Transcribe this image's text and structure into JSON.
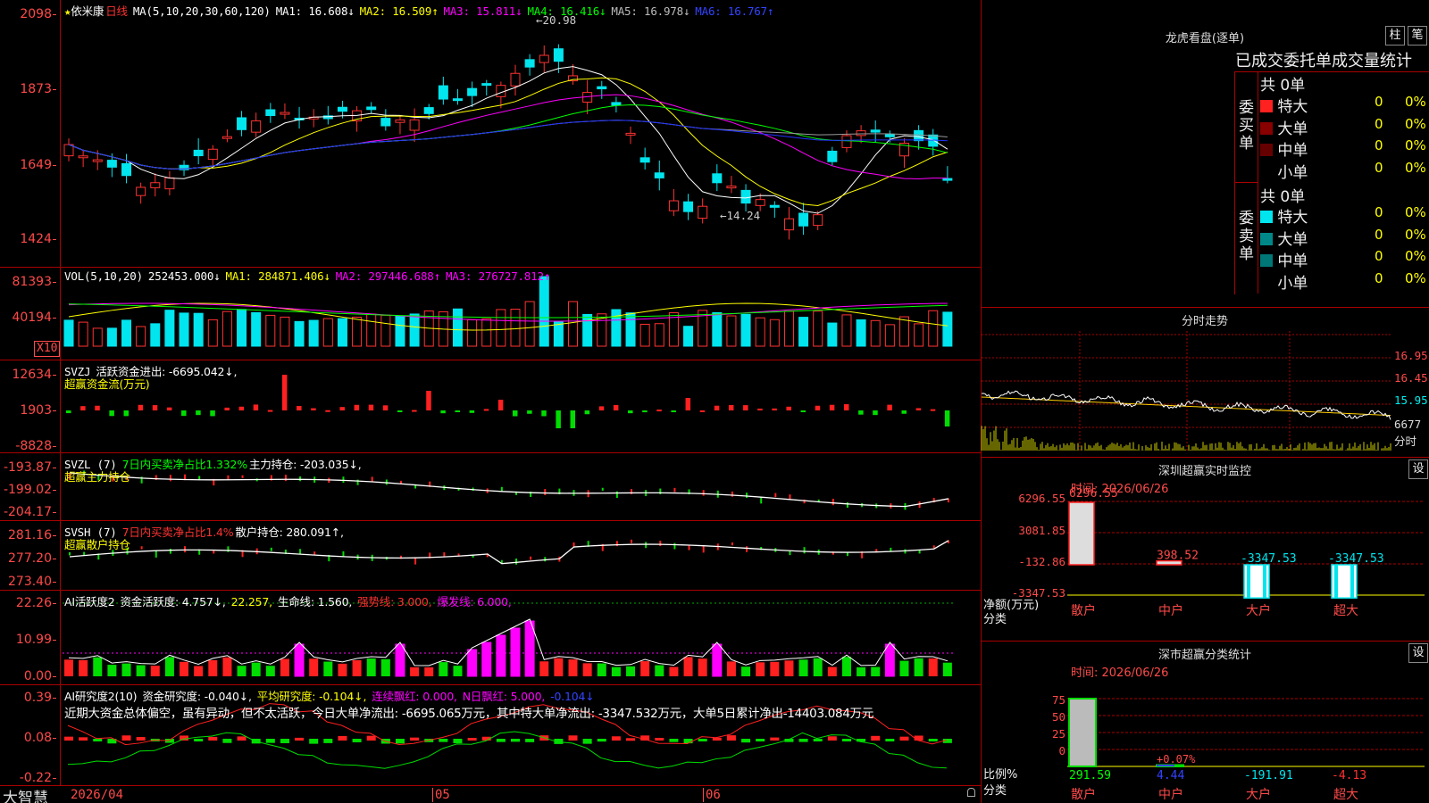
{
  "app": {
    "name": "大智慧",
    "stock": "依米康",
    "period": "日线"
  },
  "colors": {
    "up": "#ff3232",
    "down": "#00e5ee",
    "ma1": "#ffffff",
    "ma2": "#ffff00",
    "ma3": "#ff00ff",
    "ma4": "#00ff00",
    "ma5": "#999999",
    "ma6": "#2233ff",
    "axis": "#ff4a4a",
    "grid": "#aa0000"
  },
  "kline": {
    "header": {
      "ma_label": "MA(5,10,20,30,60,120)",
      "ma1": "MA1: 16.608↓",
      "ma2": "MA2: 16.509↑",
      "ma3": "MA3: 15.811↓",
      "ma4": "MA4: 16.416↓",
      "ma5": "MA5: 16.978↓",
      "ma6": "MA6: 16.767↑"
    },
    "ticks": [
      "2098",
      "1873",
      "1649",
      "1424"
    ],
    "high_label": "20.98",
    "low_label": "14.24"
  },
  "vol": {
    "header": {
      "label": "VOL(5,10,20)",
      "value": "252453.000↓",
      "ma1": "MA1: 284871.406↓",
      "ma2": "MA2: 297446.688↑",
      "ma3": "MA3: 276727.812↑"
    },
    "ticks": [
      "81393",
      "40194"
    ],
    "unit": "X10"
  },
  "svzj": {
    "header": {
      "label": "SVZJ",
      "text": "活跃资金进出: -6695.042↓,",
      "sub": "超赢资金流(万元)"
    },
    "ticks": [
      "12634",
      "1903",
      "-8828"
    ]
  },
  "svzl": {
    "header": {
      "label": "SVZL (7)",
      "text1": "7日内买卖净占比1.332%",
      "text2": "主力持仓: -203.035↓,",
      "sub": "超赢主力持仓"
    },
    "ticks": [
      "-193.87",
      "-199.02",
      "-204.17"
    ]
  },
  "svsh": {
    "header": {
      "label": "SVSH (7)",
      "text1": "7日内买卖净占比1.4%",
      "text2": "散户持仓: 280.091↑,",
      "sub": "超赢散户持仓"
    },
    "ticks": [
      "281.16",
      "277.20",
      "273.40"
    ]
  },
  "ai1": {
    "header": {
      "label": "AI活跃度2",
      "a": "资金活跃度: 4.757↓,",
      "b": "22.257,",
      "c": "生命线: 1.560,",
      "d": "强势线: 3.000,",
      "e": "爆发线: 6.000,"
    },
    "ticks": [
      "22.26",
      "10.99",
      "0.00"
    ]
  },
  "ai2": {
    "header": {
      "label": "AI研究度2(10)",
      "a": "资金研究度: -0.040↓,",
      "b": "平均研究度: -0.104↓,",
      "c": "连续飘红: 0.000,",
      "d": "N日飘红: 5.000,",
      "e": "-0.104↓"
    },
    "ticks": [
      "0.39",
      "0.08",
      "-0.22"
    ],
    "comment": "近期大资金总体偏空，虽有异动，但不太活跃，今日大单净流出: -6695.065万元，其中特大单净流出: -3347.532万元，大单5日累计净出-14403.084万元"
  },
  "dates": [
    "2026/04",
    "05",
    "06"
  ],
  "right": {
    "lhb": {
      "title": "龙虎看盘(逐单)",
      "btn1": "柱",
      "btn2": "笔",
      "subtitle": "已成交委托单成交量统计",
      "buy_label": "委买单",
      "sell_label": "委卖单",
      "buy_total": "共 0单",
      "sell_total": "共 0单",
      "buy": [
        {
          "name": "特大",
          "color": "#ff2020",
          "v": "0",
          "p": "0%"
        },
        {
          "name": "大单",
          "color": "#880000",
          "v": "0",
          "p": "0%"
        },
        {
          "name": "中单",
          "color": "#660000",
          "v": "0",
          "p": "0%"
        },
        {
          "name": "小单",
          "color": "#000000",
          "v": "0",
          "p": "0%"
        }
      ],
      "sell": [
        {
          "name": "特大",
          "color": "#00e5ee",
          "v": "0",
          "p": "0%"
        },
        {
          "name": "大单",
          "color": "#008888",
          "v": "0",
          "p": "0%"
        },
        {
          "name": "中单",
          "color": "#007777",
          "v": "0",
          "p": "0%"
        },
        {
          "name": "小单",
          "color": "#000000",
          "v": "0",
          "p": "0%"
        }
      ]
    },
    "fenshi": {
      "title": "分时走势",
      "ticks": [
        "16.95",
        "16.45",
        "15.95",
        "6677"
      ],
      "foot": "分时"
    },
    "monitor": {
      "title": "深圳超赢实时监控",
      "btn": "设",
      "date": "时间: 2026/06/26",
      "ticks": [
        "6296.55",
        "3081.85",
        "-132.86",
        "-3347.53"
      ],
      "ylabel": "净额(万元)",
      "xlabel": "分类",
      "bars": [
        {
          "cat": "散户",
          "val": "6296.55",
          "v": 6296.55
        },
        {
          "cat": "中户",
          "val": "398.52",
          "v": 398.52
        },
        {
          "cat": "大户",
          "val": "-3347.53",
          "v": -3347.53
        },
        {
          "cat": "超大",
          "val": "-3347.53",
          "v": -3347.53
        }
      ]
    },
    "classstat": {
      "title": "深市超赢分类统计",
      "btn": "设",
      "date": "时间: 2026/06/26",
      "ticks": [
        "75",
        "50",
        "25",
        "0"
      ],
      "ylabel": "比例%",
      "xlabel": "分类",
      "bars": [
        {
          "cat": "散户",
          "val": "291.59",
          "v": 100
        },
        {
          "cat": "中户",
          "val": "4.44",
          "note": "+0.07%",
          "v": 2
        },
        {
          "cat": "大户",
          "val": "-191.91",
          "v": 0
        },
        {
          "cat": "超大",
          "val": "-4.13",
          "v": 0
        }
      ]
    }
  }
}
